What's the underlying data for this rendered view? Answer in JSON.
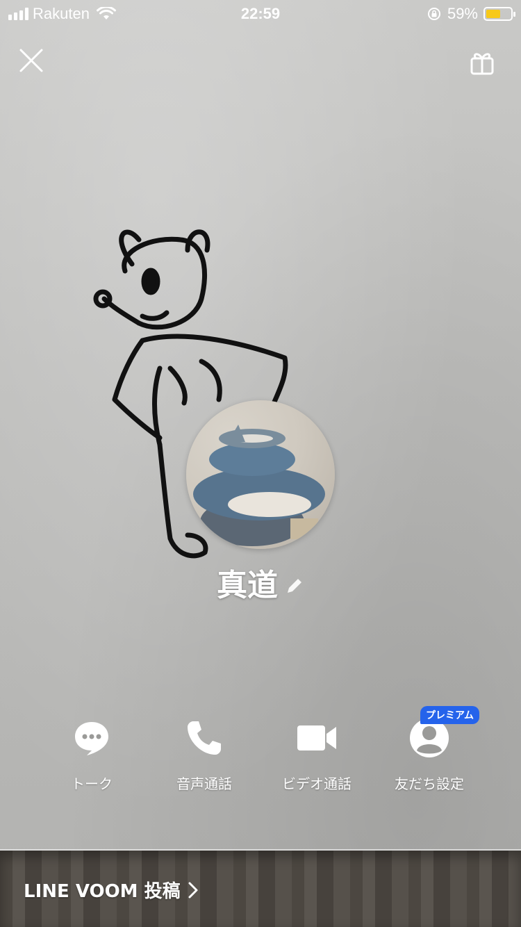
{
  "status_bar": {
    "carrier": "Rakuten",
    "time": "22:59",
    "battery_percent": "59%",
    "battery_level": 0.59,
    "icons": [
      "signal-icon",
      "wifi-icon",
      "orientation-lock-icon",
      "battery-icon"
    ]
  },
  "header": {
    "close_icon": "close-icon",
    "gift_icon": "gift-icon"
  },
  "profile": {
    "name": "真道",
    "edit_icon": "pencil-icon"
  },
  "actions": [
    {
      "label": "トーク",
      "icon": "chat-bubble-icon"
    },
    {
      "label": "音声通話",
      "icon": "phone-icon"
    },
    {
      "label": "ビデオ通話",
      "icon": "video-camera-icon"
    },
    {
      "label": "友だち設定",
      "icon": "user-icon",
      "badge": "プレミアム"
    }
  ],
  "footer": {
    "voom_link": "LINE VOOM 投稿",
    "chevron_icon": "chevron-right-icon"
  },
  "colors": {
    "premium_badge": "#2563eb",
    "battery_fill": "#f7c918"
  }
}
